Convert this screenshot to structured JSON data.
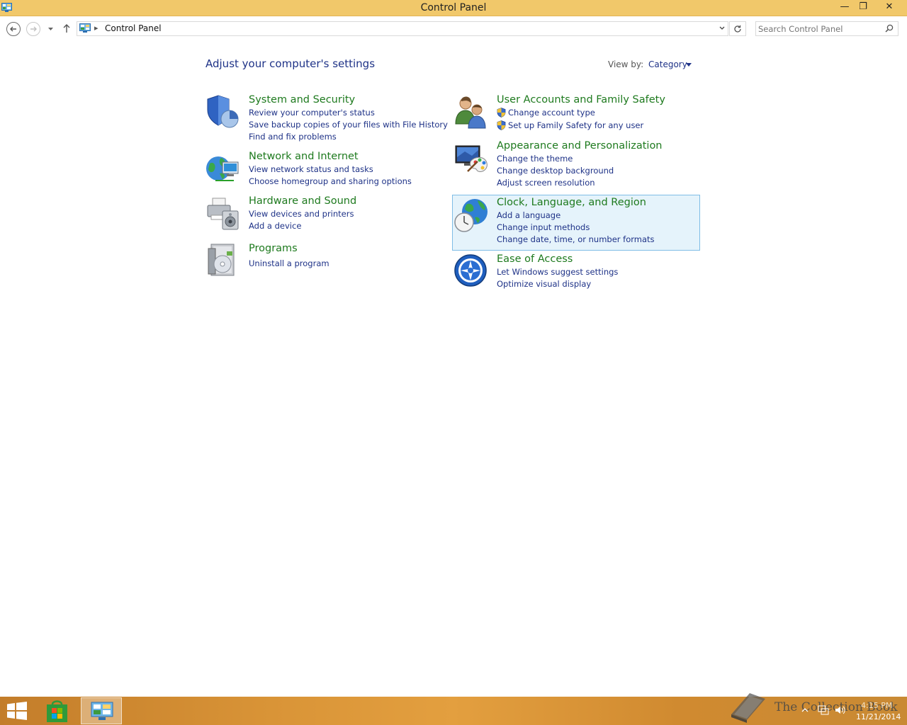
{
  "window": {
    "title": "Control Panel",
    "minimize_glyph": "—",
    "restore_glyph": "❐",
    "close_glyph": "✕"
  },
  "address": {
    "crumb": "Control Panel",
    "search_placeholder": "Search Control Panel"
  },
  "main": {
    "heading": "Adjust your computer's settings",
    "view_by_label": "View by:",
    "view_by_value": "Category"
  },
  "categories": {
    "system_security": {
      "icon": "shield-icon",
      "title": "System and Security",
      "links": [
        "Review your computer's status",
        "Save backup copies of your files with File History",
        "Find and fix problems"
      ]
    },
    "network_internet": {
      "icon": "network-globe-icon",
      "title": "Network and Internet",
      "links": [
        "View network status and tasks",
        "Choose homegroup and sharing options"
      ]
    },
    "hardware_sound": {
      "icon": "printer-speaker-icon",
      "title": "Hardware and Sound",
      "links": [
        "View devices and printers",
        "Add a device"
      ]
    },
    "programs": {
      "icon": "programs-disc-icon",
      "title": "Programs",
      "links": [
        "Uninstall a program"
      ]
    },
    "user_accounts": {
      "icon": "users-icon",
      "title": "User Accounts and Family Safety",
      "links": [
        "Change account type",
        "Set up Family Safety for any user"
      ]
    },
    "appearance": {
      "icon": "monitor-palette-icon",
      "title": "Appearance and Personalization",
      "links": [
        "Change the theme",
        "Change desktop background",
        "Adjust screen resolution"
      ]
    },
    "clock_region": {
      "icon": "globe-clock-icon",
      "title": "Clock, Language, and Region",
      "links": [
        "Add a language",
        "Change input methods",
        "Change date, time, or number formats"
      ]
    },
    "ease_access": {
      "icon": "ease-of-access-icon",
      "title": "Ease of Access",
      "links": [
        "Let Windows suggest settings",
        "Optimize visual display"
      ]
    }
  },
  "taskbar": {
    "watermark": "The Collection Book",
    "time": "4:15 PM",
    "date": "11/21/2014"
  },
  "colors": {
    "titlebar": "#f1c86a",
    "link": "#1e3287",
    "category_title": "#1e7a1e",
    "selected_bg": "#e5f3fb"
  }
}
